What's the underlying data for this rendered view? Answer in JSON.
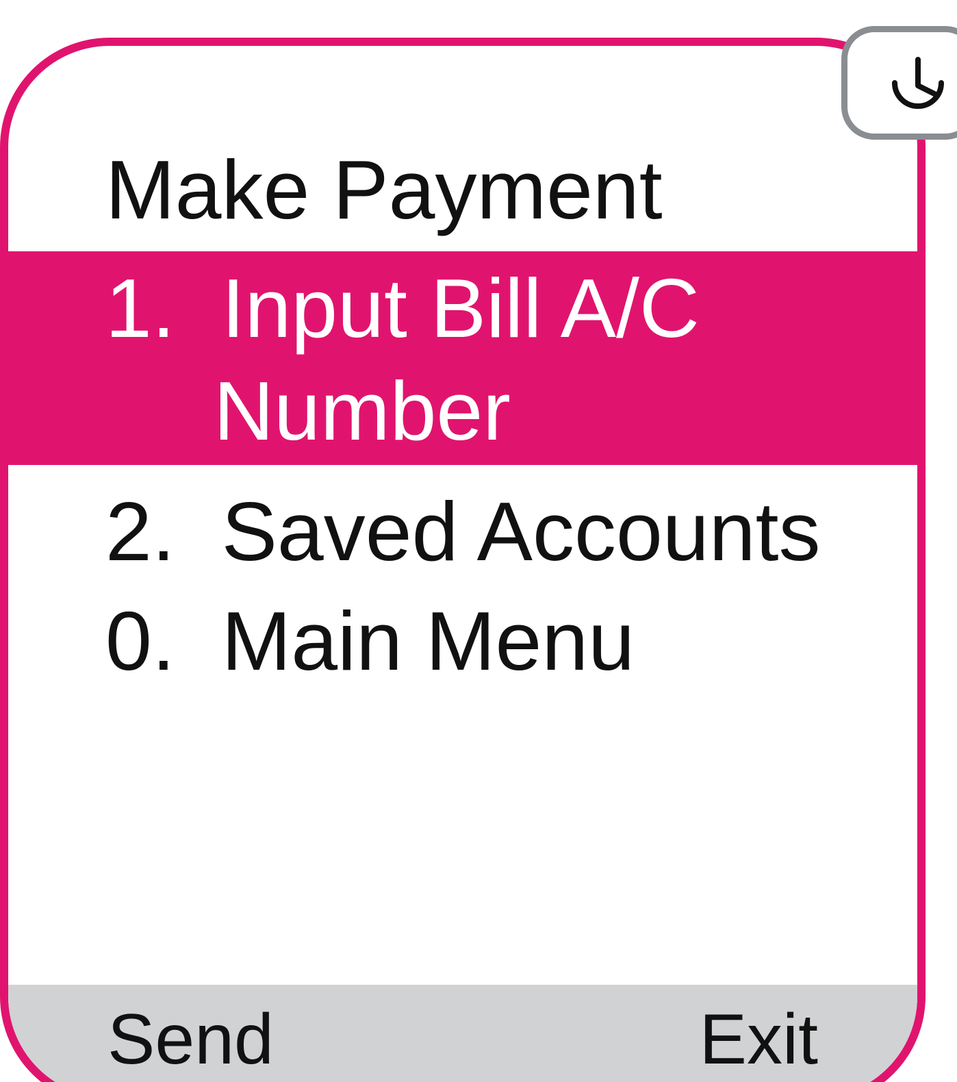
{
  "screen": {
    "title": "Make Payment",
    "accent_color": "#e0146e",
    "softkey_bar_color": "#d1d2d4"
  },
  "menu": {
    "items": [
      {
        "number": "1.",
        "label_line1": "Input Bill A/C",
        "label_line2": "Number",
        "selected": true
      },
      {
        "number": "2.",
        "label": "Saved Accounts",
        "selected": false
      },
      {
        "number": "0.",
        "label": "Main Menu",
        "selected": false
      }
    ]
  },
  "softkeys": {
    "left": "Send",
    "right": "Exit"
  },
  "history_button": {
    "icon": "history-icon"
  }
}
